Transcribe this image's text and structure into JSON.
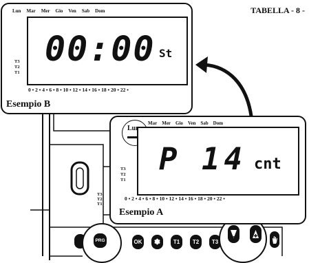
{
  "page_title": "TABELLA - 8 -",
  "example_b": {
    "caption": "Esempio B",
    "days": [
      "Lun",
      "Mar",
      "Mer",
      "Gio",
      "Ven",
      "Sab",
      "Dom"
    ],
    "time": "00:00",
    "unit": "St",
    "levels": [
      "T3",
      "T2",
      "T1"
    ],
    "hours_scale": "0 • 2 • 4 • 6 • 8 • 10 • 12 • 14 • 16 • 18 • 20 • 22 •"
  },
  "example_a": {
    "caption": "Esempio A",
    "days": [
      "Mar",
      "Mer",
      "Gio",
      "Ven",
      "Sab",
      "Dom"
    ],
    "selected_day": "Lun",
    "program": "P",
    "value": "14",
    "unit": "cnt",
    "levels": [
      "T3",
      "T2",
      "T1"
    ],
    "hours_scale": "0 • 2 • 4 • 6 • 8 • 10 • 12 • 14 • 16 • 18 • 20 • 22 •"
  },
  "device": {
    "levels": [
      "T3",
      "T2",
      "T1"
    ],
    "buttons": [
      "PRG",
      "OK",
      "✽",
      "T1",
      "T2",
      "T3"
    ],
    "button_icons": [
      "arrow-down-icon",
      "arrow-up-icon",
      "hand-icon"
    ]
  }
}
